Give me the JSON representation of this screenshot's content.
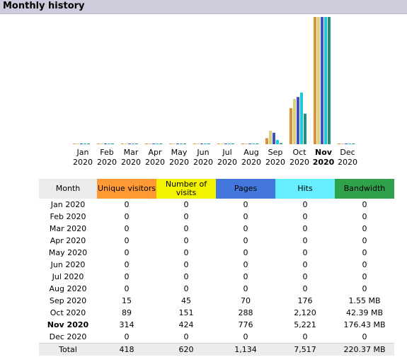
{
  "header": {
    "title": "Monthly history"
  },
  "colors": {
    "unique": "#e0902f",
    "visits": "#d8cf83",
    "pages": "#3c50c8",
    "hits": "#1fc8d4",
    "bandwidth": "#21927a"
  },
  "chart_data": {
    "type": "bar",
    "categories": [
      "Jan 2020",
      "Feb 2020",
      "Mar 2020",
      "Apr 2020",
      "May 2020",
      "Jun 2020",
      "Jul 2020",
      "Aug 2020",
      "Sep 2020",
      "Oct 2020",
      "Nov 2020",
      "Dec 2020"
    ],
    "month_labels": [
      "Jan",
      "Feb",
      "Mar",
      "Apr",
      "May",
      "Jun",
      "Jul",
      "Aug",
      "Sep",
      "Oct",
      "Nov",
      "Dec"
    ],
    "year_labels": [
      "2020",
      "2020",
      "2020",
      "2020",
      "2020",
      "2020",
      "2020",
      "2020",
      "2020",
      "2020",
      "2020",
      "2020"
    ],
    "selected_index": 10,
    "series": [
      {
        "key": "unique",
        "values": [
          0,
          0,
          0,
          0,
          0,
          0,
          0,
          0,
          15,
          89,
          314,
          0
        ]
      },
      {
        "key": "visits",
        "values": [
          0,
          0,
          0,
          0,
          0,
          0,
          0,
          0,
          45,
          151,
          424,
          0
        ]
      },
      {
        "key": "pages",
        "values": [
          0,
          0,
          0,
          0,
          0,
          0,
          0,
          0,
          70,
          288,
          776,
          0
        ]
      },
      {
        "key": "hits",
        "values": [
          0,
          0,
          0,
          0,
          0,
          0,
          0,
          0,
          176,
          2120,
          5221,
          0
        ]
      },
      {
        "key": "bandwidth",
        "values": [
          0,
          0,
          0,
          0,
          0,
          0,
          0,
          0,
          1.55,
          42.39,
          176.43,
          0
        ]
      }
    ]
  },
  "table": {
    "headers": {
      "month": "Month",
      "unique": "Unique visitors",
      "visits": "Number of visits",
      "pages": "Pages",
      "hits": "Hits",
      "bandwidth": "Bandwidth"
    },
    "rows": [
      {
        "month": "Jan 2020",
        "unique": "0",
        "visits": "0",
        "pages": "0",
        "hits": "0",
        "bandwidth": "0"
      },
      {
        "month": "Feb 2020",
        "unique": "0",
        "visits": "0",
        "pages": "0",
        "hits": "0",
        "bandwidth": "0"
      },
      {
        "month": "Mar 2020",
        "unique": "0",
        "visits": "0",
        "pages": "0",
        "hits": "0",
        "bandwidth": "0"
      },
      {
        "month": "Apr 2020",
        "unique": "0",
        "visits": "0",
        "pages": "0",
        "hits": "0",
        "bandwidth": "0"
      },
      {
        "month": "May 2020",
        "unique": "0",
        "visits": "0",
        "pages": "0",
        "hits": "0",
        "bandwidth": "0"
      },
      {
        "month": "Jun 2020",
        "unique": "0",
        "visits": "0",
        "pages": "0",
        "hits": "0",
        "bandwidth": "0"
      },
      {
        "month": "Jul 2020",
        "unique": "0",
        "visits": "0",
        "pages": "0",
        "hits": "0",
        "bandwidth": "0"
      },
      {
        "month": "Aug 2020",
        "unique": "0",
        "visits": "0",
        "pages": "0",
        "hits": "0",
        "bandwidth": "0"
      },
      {
        "month": "Sep 2020",
        "unique": "15",
        "visits": "45",
        "pages": "70",
        "hits": "176",
        "bandwidth": "1.55 MB"
      },
      {
        "month": "Oct 2020",
        "unique": "89",
        "visits": "151",
        "pages": "288",
        "hits": "2,120",
        "bandwidth": "42.39 MB"
      },
      {
        "month": "Nov 2020",
        "unique": "314",
        "visits": "424",
        "pages": "776",
        "hits": "5,221",
        "bandwidth": "176.43 MB"
      },
      {
        "month": "Dec 2020",
        "unique": "0",
        "visits": "0",
        "pages": "0",
        "hits": "0",
        "bandwidth": "0"
      }
    ],
    "total": {
      "month": "Total",
      "unique": "418",
      "visits": "620",
      "pages": "1,134",
      "hits": "7,517",
      "bandwidth": "220.37 MB"
    }
  }
}
